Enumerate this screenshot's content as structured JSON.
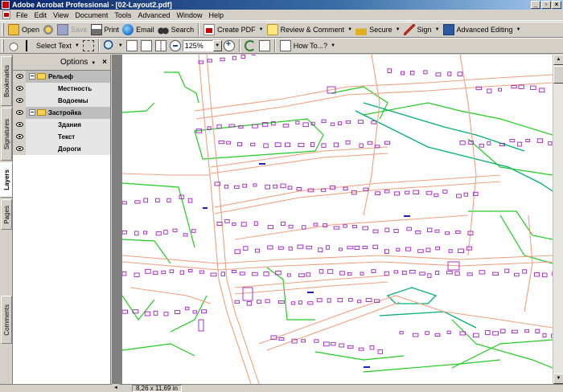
{
  "window": {
    "title": "Adobe Acrobat Professional - [02-Layout2.pdf]",
    "buttons": {
      "minimize": "_",
      "restore": "▫",
      "close": "×"
    }
  },
  "menu": [
    "File",
    "Edit",
    "View",
    "Document",
    "Tools",
    "Advanced",
    "Window",
    "Help"
  ],
  "toolbar1": {
    "open": "Open",
    "save": "Save",
    "print": "Print",
    "email": "Email",
    "search": "Search",
    "create_pdf": "Create PDF",
    "review_comment": "Review & Comment",
    "secure": "Secure",
    "sign": "Sign",
    "advanced_editing": "Advanced Editing",
    "dropdown_arrow": "▼"
  },
  "toolbar2": {
    "select_text": "Select Text",
    "zoom_value": "125%",
    "how_to": "How To...?",
    "dropdown_arrow": "▼"
  },
  "side_tabs": {
    "bookmarks": "Bookmarks",
    "signatures": "Signatures",
    "layers": "Layers",
    "pages": "Pages",
    "comments": "Comments"
  },
  "layers_panel": {
    "options": "Options",
    "close": "×",
    "expander": "−",
    "layers": [
      {
        "name": "Рельеф",
        "group": true
      },
      {
        "name": "Местность",
        "group": false
      },
      {
        "name": "Водоемы",
        "group": false
      },
      {
        "name": "Застройка",
        "group": true
      },
      {
        "name": "Здания",
        "group": false
      },
      {
        "name": "Текст",
        "group": false
      },
      {
        "name": "Дороги",
        "group": false
      }
    ]
  },
  "status": {
    "page_size": "8,26 x 11,69 in"
  },
  "scroll": {
    "up": "▲",
    "down": "▼",
    "left": "◄"
  },
  "colors": {
    "titlebar_start": "#0a246a",
    "road": "#f0a080",
    "relief": "#22cc22",
    "building": "#a020c0",
    "water": "#00b070"
  }
}
